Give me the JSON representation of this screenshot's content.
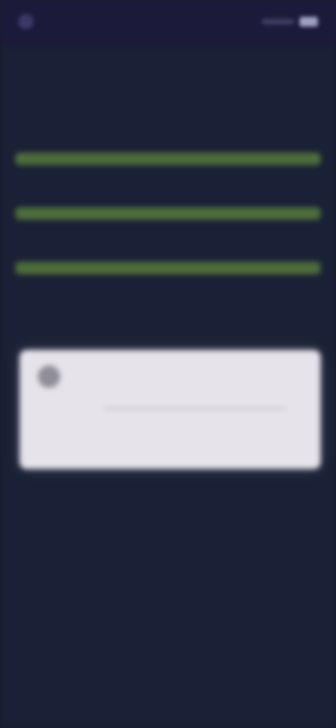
{
  "status_bar": {
    "time": "",
    "icons": [
      "app-logo-icon",
      "signal-icon",
      "battery-icon"
    ]
  },
  "main": {
    "headline": "",
    "options": [
      {
        "label": "",
        "value": ""
      },
      {
        "label": "",
        "value": ""
      },
      {
        "label": "",
        "value": ""
      }
    ],
    "section_title": "",
    "card": {
      "name": "",
      "text": ""
    }
  },
  "colors": {
    "background": "#1a2035",
    "option_bar": "#4d6d3a",
    "card": "#e6e3ea"
  }
}
